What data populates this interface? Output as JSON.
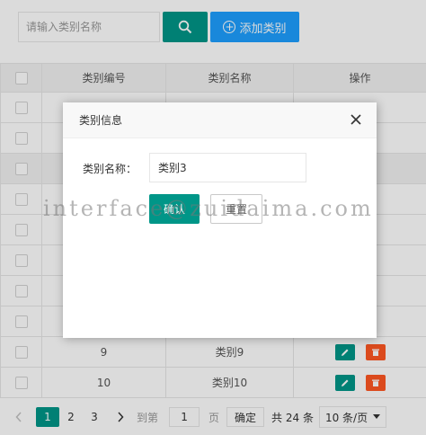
{
  "toolbar": {
    "search_placeholder": "请输入类别名称",
    "add_label": "添加类别"
  },
  "table": {
    "columns": [
      "类别编号",
      "类别名称",
      "操作"
    ],
    "rows": [
      {
        "id": "9",
        "name": "类别9"
      },
      {
        "id": "10",
        "name": "类别10"
      }
    ]
  },
  "pager": {
    "pages": [
      "1",
      "2",
      "3"
    ],
    "current_page": "1",
    "goto_label": "到第",
    "goto_value": "1",
    "page_unit": "页",
    "confirm_label": "确定",
    "total_label": "共 24 条",
    "page_size": "10 条/页"
  },
  "modal": {
    "title": "类别信息",
    "field_label": "类别名称：",
    "field_value": "类别3",
    "ok_label": "确认",
    "reset_label": "重置"
  },
  "watermark": "interface@zuidaima.com",
  "colors": {
    "primary": "#009688",
    "blue": "#1e9fff",
    "danger": "#ff5722"
  },
  "icons": [
    "search-icon",
    "plus-circle-icon",
    "edit-icon",
    "delete-icon",
    "close-icon",
    "chevron-left-icon",
    "chevron-right-icon",
    "caret-down-icon"
  ]
}
